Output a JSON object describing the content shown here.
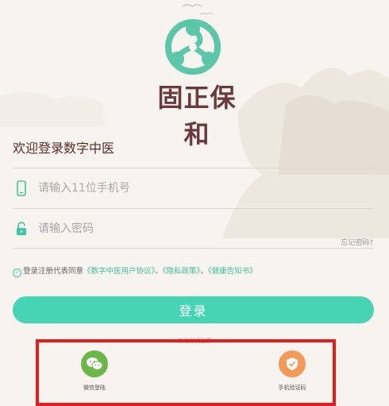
{
  "brand": {
    "name": "固正保和",
    "accent_color": "#46d4b4",
    "brand_text_color": "#6b3b3b"
  },
  "welcome_text": "欢迎登录数字中医",
  "phone": {
    "placeholder": "请输入11位手机号",
    "icon": "phone-icon"
  },
  "password": {
    "placeholder": "请输入密码",
    "icon": "lock-icon"
  },
  "forgot_label": "忘记密码?",
  "agreement": {
    "prefix": "登录注册代表同意",
    "links": [
      "《数字中医用户协议》",
      "《隐私政策》",
      "《健康告知书》"
    ],
    "separator": "、"
  },
  "login_button": "登录",
  "other_methods": {
    "title": "其他方式登录",
    "options": [
      {
        "label": "微信登陆",
        "icon": "wechat-icon",
        "color": "#6db74a"
      },
      {
        "label": "手机验证码",
        "icon": "shield-check-icon",
        "color": "#f39a5b"
      }
    ]
  }
}
